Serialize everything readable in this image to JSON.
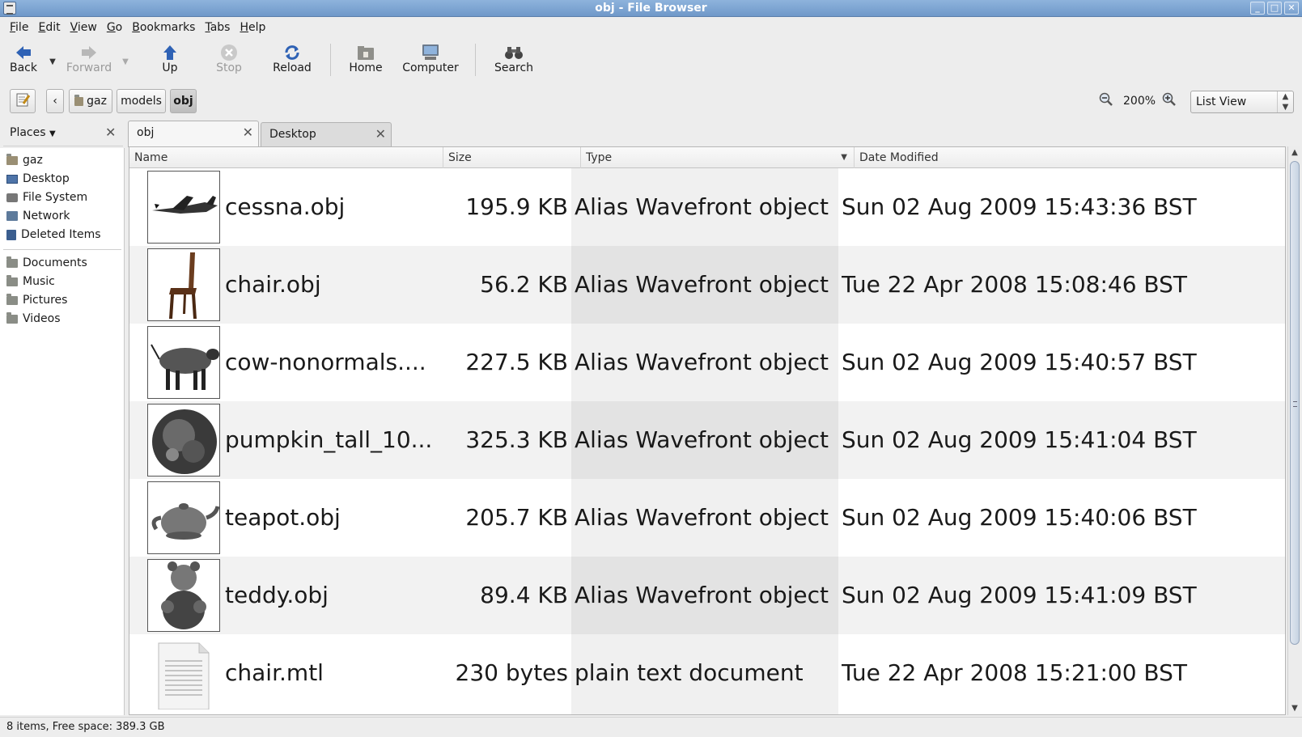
{
  "window": {
    "title": "obj - File Browser"
  },
  "menu": [
    "File",
    "Edit",
    "View",
    "Go",
    "Bookmarks",
    "Tabs",
    "Help"
  ],
  "toolbar": {
    "back": "Back",
    "forward": "Forward",
    "up": "Up",
    "stop": "Stop",
    "reload": "Reload",
    "home": "Home",
    "computer": "Computer",
    "search": "Search"
  },
  "location": {
    "crumbs": [
      "gaz",
      "models",
      "obj"
    ],
    "zoom": "200%",
    "view": "List View"
  },
  "sidebar": {
    "title": "Places",
    "places": [
      "gaz",
      "Desktop",
      "File System",
      "Network",
      "Deleted Items"
    ],
    "bookmarks": [
      "Documents",
      "Music",
      "Pictures",
      "Videos"
    ]
  },
  "tabs": [
    "obj",
    "Desktop"
  ],
  "columns": [
    "Name",
    "Size",
    "Type",
    "Date Modified"
  ],
  "files": [
    {
      "name": "cessna.obj",
      "size": "195.9 KB",
      "type": "Alias Wavefront object",
      "date": "Sun 02 Aug 2009 15:43:36 BST",
      "thumb": "cessna"
    },
    {
      "name": "chair.obj",
      "size": "56.2 KB",
      "type": "Alias Wavefront object",
      "date": "Tue 22 Apr 2008 15:08:46 BST",
      "thumb": "chair"
    },
    {
      "name": "cow-nonormals....",
      "size": "227.5 KB",
      "type": "Alias Wavefront object",
      "date": "Sun 02 Aug 2009 15:40:57 BST",
      "thumb": "cow"
    },
    {
      "name": "pumpkin_tall_10...",
      "size": "325.3 KB",
      "type": "Alias Wavefront object",
      "date": "Sun 02 Aug 2009 15:41:04 BST",
      "thumb": "pumpkin"
    },
    {
      "name": "teapot.obj",
      "size": "205.7 KB",
      "type": "Alias Wavefront object",
      "date": "Sun 02 Aug 2009 15:40:06 BST",
      "thumb": "teapot"
    },
    {
      "name": "teddy.obj",
      "size": "89.4 KB",
      "type": "Alias Wavefront object",
      "date": "Sun 02 Aug 2009 15:41:09 BST",
      "thumb": "teddy"
    },
    {
      "name": "chair.mtl",
      "size": "230 bytes",
      "type": "plain text document",
      "date": "Tue 22 Apr 2008 15:21:00 BST",
      "thumb": "text"
    }
  ],
  "status": "8 items, Free space: 389.3 GB"
}
